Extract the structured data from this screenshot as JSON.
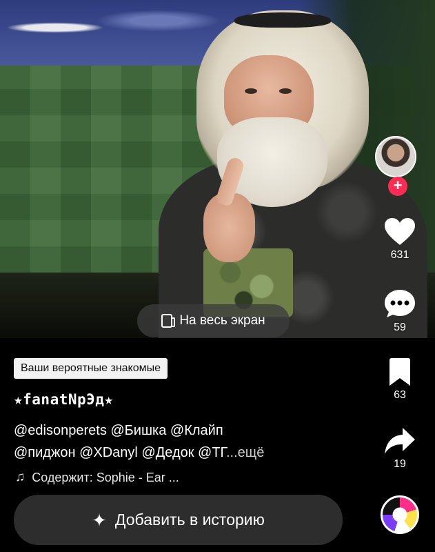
{
  "video": {
    "fullscreen_label": "На весь экран"
  },
  "rail": {
    "follow_symbol": "+",
    "likes": "631",
    "comments": "59",
    "saves": "63",
    "shares": "19",
    "accent_color": "#fe2c55"
  },
  "info": {
    "badge": "Ваши вероятные знакомые",
    "username": "★fanatNpЭд★",
    "caption_line1": "@edisonperets @Бишка @Клайп",
    "caption_line2": "@пиджон @XDanyl @Дедок @ТГ",
    "more": "...ещё",
    "sound": "Содержит: Sophie - Ear ..."
  },
  "story_button": {
    "label": "Добавить в историю"
  },
  "icons": [
    "fullscreen-icon",
    "plus-icon",
    "heart-icon",
    "comment-icon",
    "bookmark-icon",
    "share-icon",
    "music-note-icon",
    "sparkle-icon",
    "music-disc-icon"
  ]
}
